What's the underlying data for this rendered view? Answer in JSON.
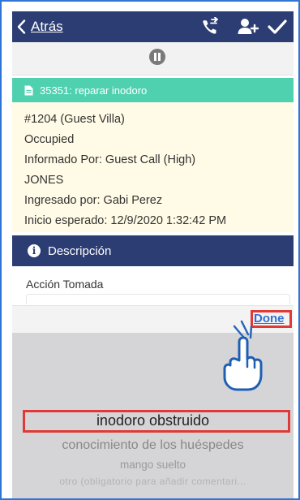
{
  "nav": {
    "back_label": "Atrás",
    "icons": [
      "phone-forward-icon",
      "add-user-icon",
      "checkmark-icon"
    ]
  },
  "pause": {
    "icon": "pause-icon"
  },
  "task": {
    "title": "35351: reparar inodoro",
    "icon": "document-icon"
  },
  "info": {
    "lines": [
      "#1204 (Guest Villa)",
      "Occupied",
      "Informado Por: Guest Call  (High)",
      "JONES",
      "Ingresado por: Gabi Perez",
      "Inicio esperado: 12/9/2020 1:32:42 PM"
    ]
  },
  "description": {
    "label": "Descripción",
    "icon": "info-icon"
  },
  "action": {
    "label": "Acción Tomada",
    "value": ""
  },
  "toolbar": {
    "done_label": "Done"
  },
  "picker": {
    "selected": "inodoro obstruido",
    "options": [
      "inodoro obstruido",
      "conocimiento de los huéspedes",
      "mango suelto",
      "otro (obligatorio para añadir comentari..."
    ]
  },
  "colors": {
    "navbar": "#2c3d73",
    "task_bar": "#4fd1b0",
    "info_bg": "#fffbe6",
    "highlight_box": "#e03a36",
    "done_link": "#2f6fd8",
    "picker_bg": "#d5d5d8"
  }
}
